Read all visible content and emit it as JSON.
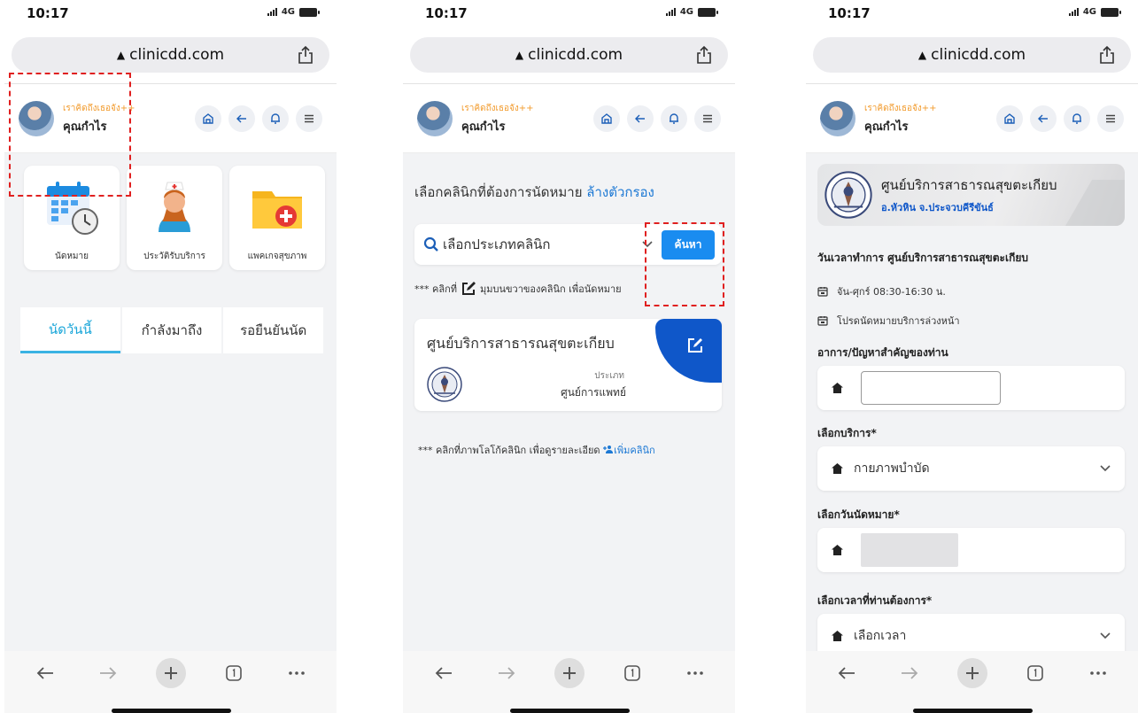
{
  "status": {
    "time": "10:17",
    "network": "4G"
  },
  "browser": {
    "domain": "clinicdd.com"
  },
  "header": {
    "greeting": "เราคิดถึงเธอจัง++",
    "user_name": "คุณกำไร"
  },
  "screen1": {
    "menu": [
      {
        "label": "นัดหมาย",
        "icon": "calendar-clock-icon"
      },
      {
        "label": "ประวัติรับบริการ",
        "icon": "nurse-icon"
      },
      {
        "label": "แพคเกจสุขภาพ",
        "icon": "health-folder-icon"
      }
    ],
    "tabs": [
      "นัดวันนี้",
      "กำลังมาถึง",
      "รอยืนยันนัด"
    ]
  },
  "screen2": {
    "title": "เลือกคลินิกที่ต้องการนัดหมาย",
    "clear_filter": "ล้างตัวกรอง",
    "select_placeholder": "เลือกประเภทคลินิก",
    "search_button": "ค้นหา",
    "hint_prefix": "*** คลิกที่",
    "hint_suffix": "มุมบนขวาของคลินิก เพื่อนัดหมาย",
    "clinic": {
      "name": "ศูนย์บริการสาธารณสุขตะเกียบ",
      "type_label": "ประเภท",
      "type": "ศูนย์การแพทย์"
    },
    "hint2": "*** คลิกที่ภาพโลโก้คลินิก เพื่อดูรายละเอียด",
    "add_clinic": "เพิ่มคลินิก"
  },
  "screen3": {
    "clinic_name": "ศูนย์บริการสาธารณสุขตะเกียบ",
    "clinic_location": "อ.หัวหิน จ.ประจวบคีรีขันธ์",
    "hours_title": "วันเวลาทำการ  ศูนย์บริการสาธารณสุขตะเกียบ",
    "hours": "จัน-ศุกร์ 08:30-16:30 น.",
    "advance_note": "โปรดนัดหมายบริการล่วงหน้า",
    "symptom_label": "อาการ/ปัญหาสำคัญของท่าน",
    "service_label": "เลือกบริการ*",
    "service_value": "กายภาพบำบัด",
    "date_label": "เลือกวันนัดหมาย*",
    "time_label": "เลือกเวลาที่ท่านต้องการ*",
    "time_placeholder": "เลือกเวลา"
  },
  "colors": {
    "accent_blue": "#1c78d4",
    "highlight_red": "#e02020",
    "active_tab": "#1aa6d9",
    "greeting": "#f29b2d"
  }
}
